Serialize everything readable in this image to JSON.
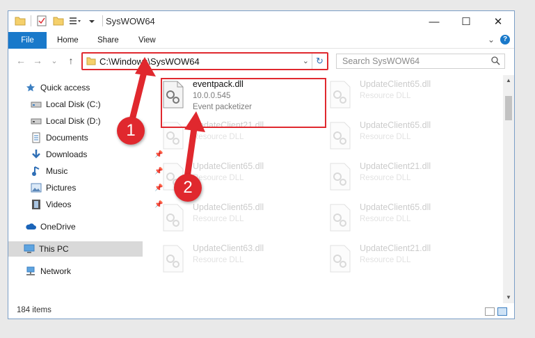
{
  "window": {
    "title": "SysWOW64",
    "controls": {
      "minimize": "—",
      "maximize": "☐",
      "close": "✕"
    }
  },
  "ribbon": {
    "tabs": [
      "File",
      "Home",
      "Share",
      "View"
    ],
    "help": "?",
    "expand": "⌄"
  },
  "address": {
    "path": "C:\\Windows\\SysWOW64",
    "dropdown": "⌄",
    "refresh": "↻",
    "search_placeholder": "Search SysWOW64"
  },
  "nav": {
    "back": "←",
    "forward": "→",
    "recent": "⌄",
    "up": "↑",
    "items": [
      {
        "label": "Quick access",
        "icon": "star-icon"
      },
      {
        "label": "Local Disk (C:)",
        "icon": "drive-icon"
      },
      {
        "label": "Local Disk (D:)",
        "icon": "drive-icon"
      },
      {
        "label": "Documents",
        "icon": "documents-icon"
      },
      {
        "label": "Downloads",
        "icon": "download-icon"
      },
      {
        "label": "Music",
        "icon": "music-icon"
      },
      {
        "label": "Pictures",
        "icon": "pictures-icon"
      },
      {
        "label": "Videos",
        "icon": "videos-icon"
      },
      {
        "label": "OneDrive",
        "icon": "cloud-icon"
      },
      {
        "label": "This PC",
        "icon": "computer-icon"
      },
      {
        "label": "Network",
        "icon": "network-icon"
      }
    ]
  },
  "files": [
    {
      "name": "eventpack.dll",
      "version": "10.0.0.545",
      "description": "Event packetizer"
    },
    {
      "name": "UpdateClient65.dll",
      "description": "Resource DLL"
    },
    {
      "name": "UpdateClient21.dll",
      "description": "Resource DLL"
    },
    {
      "name": "UpdateClient65.dll",
      "description": "Resource DLL"
    },
    {
      "name": "UpdateClient65.dll",
      "description": "Resource DLL"
    },
    {
      "name": "UpdateClient21.dll",
      "description": "Resource DLL"
    },
    {
      "name": "UpdateClient65.dll",
      "description": "Resource DLL"
    },
    {
      "name": "UpdateClient65.dll",
      "description": "Resource DLL"
    },
    {
      "name": "UpdateClient63.dll",
      "description": "Resource DLL"
    },
    {
      "name": "UpdateClient21.dll",
      "description": "Resource DLL"
    }
  ],
  "status": {
    "count": "184 items"
  },
  "annotations": {
    "step1": "1",
    "step2": "2"
  },
  "colors": {
    "highlight": "#e0282e",
    "accent": "#1979ca"
  }
}
